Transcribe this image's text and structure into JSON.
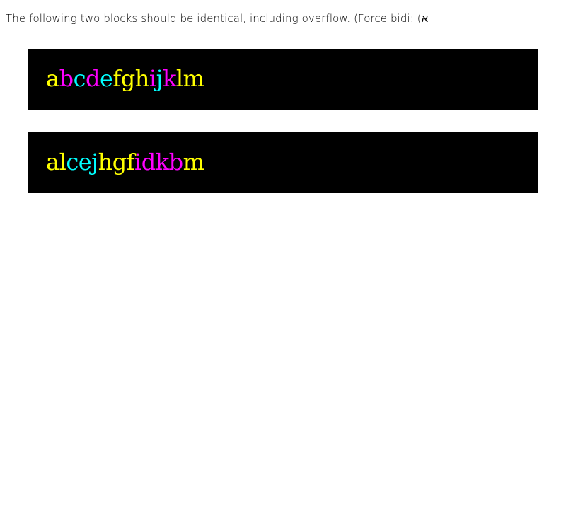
{
  "intro": {
    "text": "The following two blocks should be identical, including overflow. (Force bidi: (א"
  },
  "colors": {
    "yellow": "#ffff00",
    "cyan": "#00ffff",
    "magenta": "#ff00ff",
    "block_background": "#000000"
  },
  "blocks": [
    {
      "glyphs": [
        {
          "ch": "a",
          "color": "yellow"
        },
        {
          "ch": "b",
          "color": "magenta"
        },
        {
          "ch": "c",
          "color": "cyan"
        },
        {
          "ch": "d",
          "color": "magenta"
        },
        {
          "ch": "e",
          "color": "cyan"
        },
        {
          "ch": "f",
          "color": "yellow"
        },
        {
          "ch": "g",
          "color": "yellow"
        },
        {
          "ch": "h",
          "color": "yellow"
        },
        {
          "ch": "i",
          "color": "magenta"
        },
        {
          "ch": "j",
          "color": "cyan"
        },
        {
          "ch": "k",
          "color": "magenta"
        },
        {
          "ch": "l",
          "color": "yellow"
        },
        {
          "ch": "m",
          "color": "yellow"
        }
      ]
    },
    {
      "glyphs": [
        {
          "ch": "a",
          "color": "yellow"
        },
        {
          "ch": "l",
          "color": "yellow"
        },
        {
          "ch": "c",
          "color": "cyan"
        },
        {
          "ch": "e",
          "color": "cyan"
        },
        {
          "ch": "j",
          "color": "cyan"
        },
        {
          "ch": "h",
          "color": "yellow"
        },
        {
          "ch": "g",
          "color": "yellow"
        },
        {
          "ch": "f",
          "color": "yellow"
        },
        {
          "ch": "i",
          "color": "magenta"
        },
        {
          "ch": "d",
          "color": "magenta"
        },
        {
          "ch": "k",
          "color": "magenta"
        },
        {
          "ch": "b",
          "color": "magenta"
        },
        {
          "ch": "m",
          "color": "yellow"
        }
      ]
    }
  ]
}
